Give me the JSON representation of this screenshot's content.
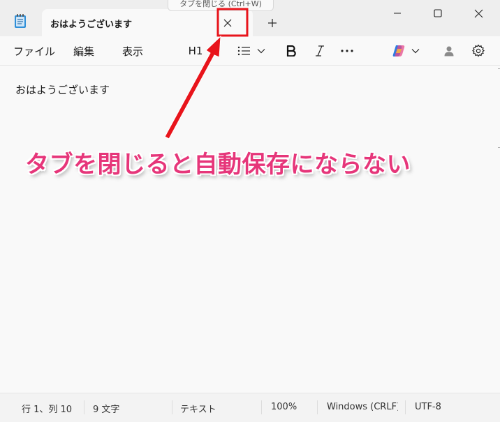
{
  "window": {
    "tab_title": "おはようございます",
    "tooltip": "タブを閉じる (Ctrl+W)"
  },
  "menu": {
    "file": "ファイル",
    "edit": "編集",
    "view": "表示",
    "heading": "H1"
  },
  "toolbar_icons": [
    "list-icon",
    "bold-icon",
    "italic-icon",
    "more-icon",
    "copilot-icon",
    "account-icon",
    "settings-icon"
  ],
  "editor": {
    "content": "おはようございます"
  },
  "annotation": {
    "text": "タブを閉じると自動保存にならない",
    "color": "#e6367a",
    "highlight_color": "#e8141b"
  },
  "status": {
    "position": "行 1、列 10",
    "char_count": "9 文字",
    "format": "テキスト",
    "zoom": "100%",
    "line_ending": "Windows (CRLF)",
    "encoding": "UTF-8"
  }
}
